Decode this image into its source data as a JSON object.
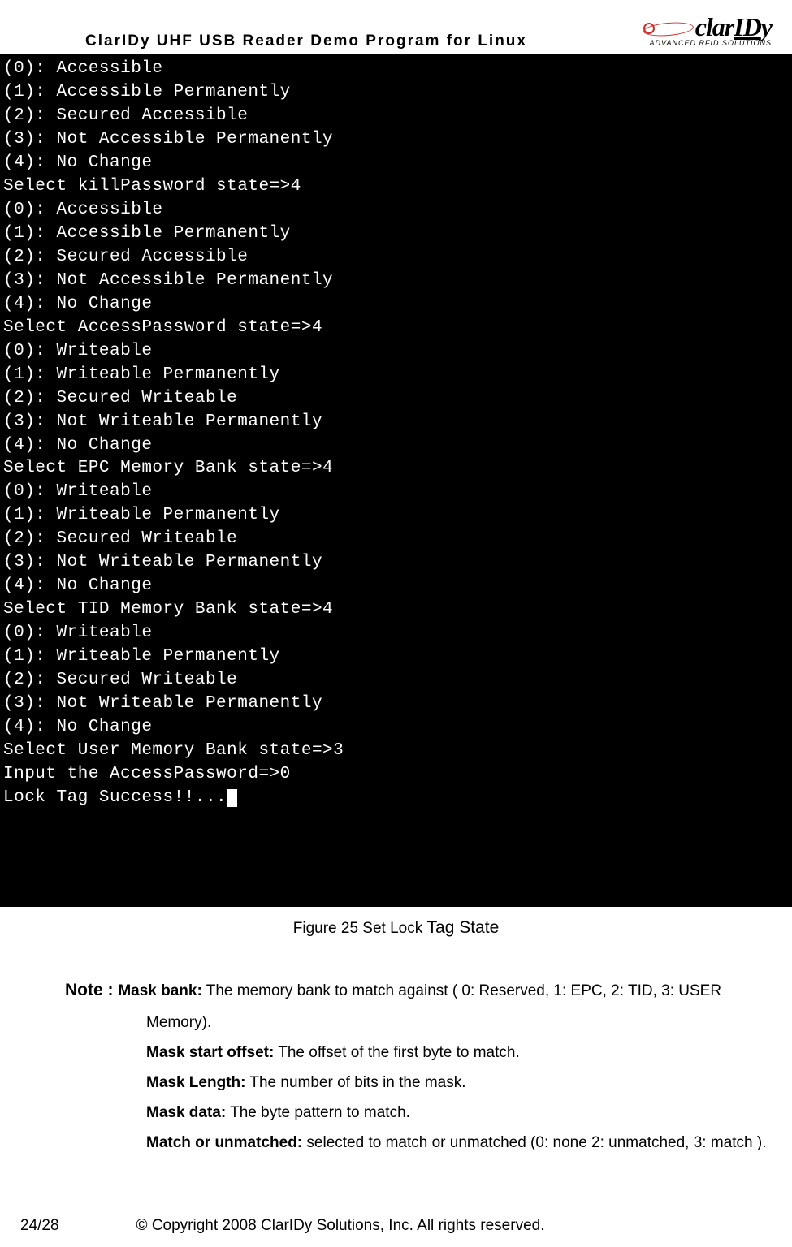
{
  "header": {
    "title": "ClarIDy UHF USB Reader Demo Program for Linux",
    "logo_text_1": "clar",
    "logo_text_2": "ID",
    "logo_text_3": "y",
    "logo_tag": "ADVANCED RFID SOLUTIONS"
  },
  "terminal": {
    "lines": [
      "(0): Accessible",
      "(1): Accessible Permanently",
      "(2): Secured Accessible",
      "(3): Not Accessible Permanently",
      "(4): No Change",
      "Select killPassword state=>4",
      "(0): Accessible",
      "(1): Accessible Permanently",
      "(2): Secured Accessible",
      "(3): Not Accessible Permanently",
      "(4): No Change",
      "Select AccessPassword state=>4",
      "(0): Writeable",
      "(1): Writeable Permanently",
      "(2): Secured Writeable",
      "(3): Not Writeable Permanently",
      "(4): No Change",
      "Select EPC Memory Bank state=>4",
      "(0): Writeable",
      "(1): Writeable Permanently",
      "(2): Secured Writeable",
      "(3): Not Writeable Permanently",
      "(4): No Change",
      "Select TID Memory Bank state=>4",
      "(0): Writeable",
      "(1): Writeable Permanently",
      "(2): Secured Writeable",
      "(3): Not Writeable Permanently",
      "(4): No Change",
      "Select User Memory Bank state=>3",
      "Input the AccessPassword=>0",
      "Lock Tag Success!!..."
    ]
  },
  "caption": {
    "prefix": "Figure 25 Set Lock ",
    "tag": "Tag State"
  },
  "notes": {
    "prefix": "Note : ",
    "items": [
      {
        "label": "Mask bank:",
        "text": " The memory bank to match against ( 0: Reserved, 1: EPC, 2: TID, 3: USER",
        "cont": "Memory)."
      },
      {
        "label": "Mask start offset:",
        "text": " The offset of the first byte to match."
      },
      {
        "label": "Mask Length:",
        "text": " The number of bits in the mask."
      },
      {
        "label": "Mask data:",
        "text": " The byte pattern to match."
      },
      {
        "label": "Match or unmatched:",
        "text": " selected to match or unmatched (0: none 2: unmatched, 3: match )."
      }
    ]
  },
  "footer": {
    "page": "24/28",
    "copyright": "© Copyright 2008 ClarIDy Solutions, Inc. All rights reserved."
  }
}
